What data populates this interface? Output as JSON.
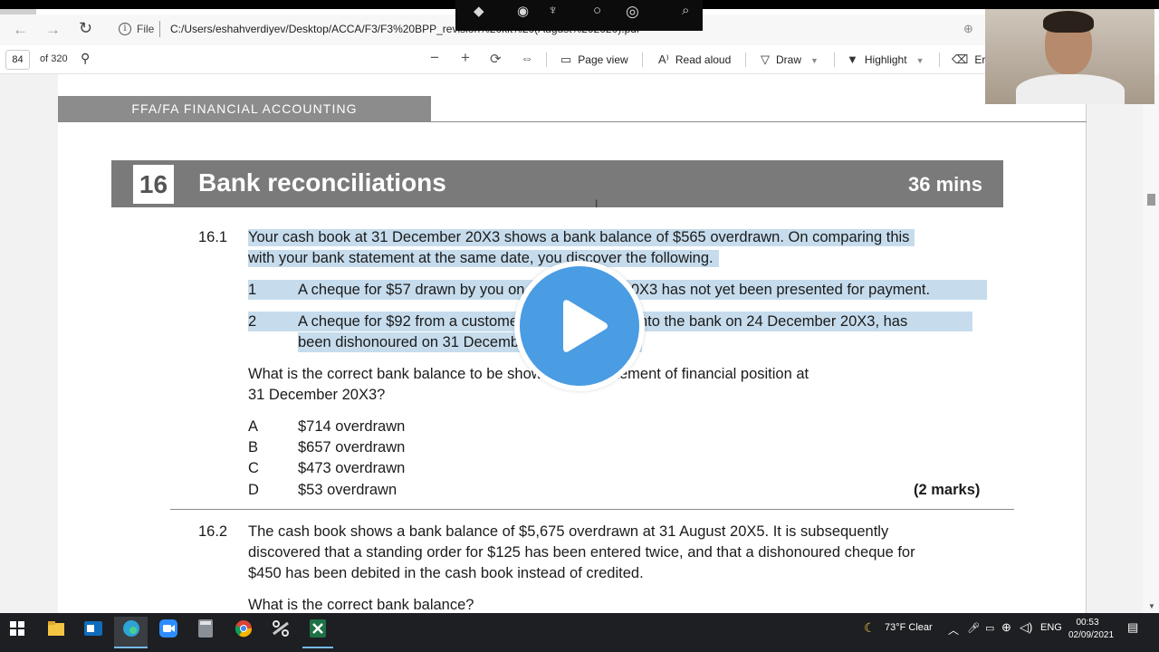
{
  "browser": {
    "file_label": "File",
    "url": "C:/Users/eshahverdiyev/Desktop/ACCA/F3/F3%20BPP_revision%20kit%20(August%202020).pdf"
  },
  "pdf_toolbar": {
    "page_number": "84",
    "page_count": "of 320",
    "page_view": "Page view",
    "read_aloud": "Read aloud",
    "draw": "Draw",
    "highlight": "Highlight",
    "erase": "Era"
  },
  "document": {
    "running_header": "FFA/FA FINANCIAL ACCOUNTING",
    "chapter_number": "16",
    "chapter_title": "Bank reconciliations",
    "chapter_time": "36 mins",
    "q1": {
      "number": "16.1",
      "text_line1": "Your cash book at 31 December 20X3 shows a bank balance of $565 overdrawn. On comparing this",
      "text_line2": "with your bank statement at the same date, you discover the following.",
      "item1_num": "1",
      "item1_text": "A cheque for $57 drawn by you on 29 December 20X3 has not yet been presented for payment.",
      "item2_num": "2",
      "item2_line1": "A cheque for $92 from a customer, which was paid into the bank on 24 December 20X3, has",
      "item2_line2": "been dishonoured on 31 December 20X3.",
      "question_line1": "What is the correct bank balance to be shown in the statement of financial position at",
      "question_line2": "31 December 20X3?",
      "options": [
        {
          "letter": "A",
          "text": "$714 overdrawn"
        },
        {
          "letter": "B",
          "text": "$657 overdrawn"
        },
        {
          "letter": "C",
          "text": "$473 overdrawn"
        },
        {
          "letter": "D",
          "text": "$53 overdrawn"
        }
      ],
      "marks": "(2 marks)"
    },
    "q2": {
      "number": "16.2",
      "line1": "The cash book shows a bank balance of $5,675 overdrawn at 31 August 20X5. It is subsequently",
      "line2": "discovered that a standing order for $125 has been entered twice, and that a dishonoured cheque for",
      "line3": "$450 has been debited in the cash book instead of credited.",
      "question": "What is the correct bank balance?"
    }
  },
  "taskbar": {
    "weather": "73°F  Clear",
    "language": "ENG",
    "time": "00:53",
    "date": "02/09/2021"
  },
  "colors": {
    "highlight": "#c6dced",
    "chapter_bar": "#7a7a7a",
    "play_button": "#4a9ce3",
    "taskbar": "#1d1f22"
  },
  "icons": [
    "back-icon",
    "forward-icon",
    "reload-icon",
    "info-icon",
    "zoom-icon",
    "search-icon",
    "zoom-out-icon",
    "zoom-in-icon",
    "rotate-icon",
    "fit-icon",
    "page-view-icon",
    "read-aloud-icon",
    "draw-icon",
    "highlight-icon",
    "erase-icon",
    "play-icon",
    "windows-icon",
    "weather-icon",
    "notification-icon"
  ]
}
